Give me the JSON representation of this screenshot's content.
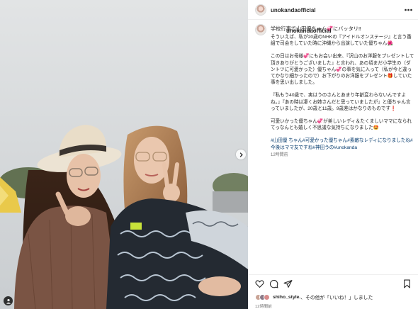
{
  "post": {
    "username": "unokandaofficial",
    "more_icon": "more-horizontal-icon"
  },
  "caption": {
    "username": "unokandaofficial",
    "headline": "学校行事で山田優ちゃん💞にバッタリ‼︎",
    "paragraphs": [
      "そういえば、私が20歳のNHKの『アイドルオンステージ』と言う番組で司会をしていた時に沖縄から出演していた優ちゃん🌺",
      "この日はお母様💞にもお会い出来、『沢山のお洋服をプレゼントして頂きありがとうございました』と言われ、あの頃まだ小学生の（ダントツに可愛かった）優ちゃん💞の事を気に入って（私が今と違ってかなり細かったので）お下がりのお洋服をプレゼント🎁していた事を思い出しました。",
      "『私もう40歳で、実はうのさんとあまり年齢変わらないんですよね。』『あの時は凄くお姉さんだと思っていましたが』と優ちゃん言っていましたが、20歳と11歳。9歳差はかなりのものです❗",
      "可愛いかった優ちゃん💞が美しいレディ＆たくましいママになられてっなんとも嬉しく不思議な気持ちになりました🤩"
    ],
    "hashtags": "#山田優 ちゃん#可愛かった優ちゃん#素敵なレディになりましたね#今後はママ友ですね#神田うの#unokanda",
    "time": "12時間前"
  },
  "actions": {
    "like_icon": "heart-icon",
    "comment_icon": "comment-icon",
    "share_icon": "send-icon",
    "save_icon": "bookmark-icon"
  },
  "likes": {
    "user": "shiho_style.",
    "suffix": "、その他が「いいね！」しました"
  },
  "post_time": "12時間前",
  "photo": {
    "next_icon": "chevron-right-icon",
    "tag_icon": "user-tag-icon"
  }
}
